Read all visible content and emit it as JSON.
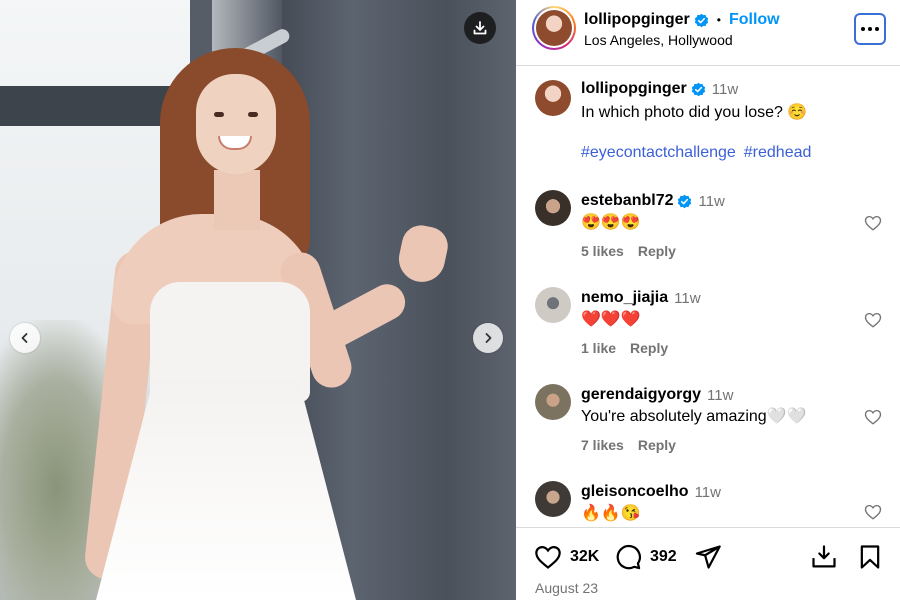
{
  "post": {
    "photo_alt_icons": {
      "download": "download-icon",
      "prev": "chevron-left-icon",
      "next": "chevron-right-icon"
    }
  },
  "header": {
    "username": "lollipopginger",
    "dot": "•",
    "follow_label": "Follow",
    "location": "Los Angeles, Hollywood",
    "more_icon": "more-options-icon"
  },
  "caption": {
    "username": "lollipopginger",
    "time": "11w",
    "text": "In which photo did you lose? ☺️",
    "hashtags": [
      "#eyecontactchallenge",
      "#redhead"
    ]
  },
  "comments": [
    {
      "username": "estebanbl72",
      "verified": true,
      "time": "11w",
      "text": "😍😍😍",
      "likes": "5 likes",
      "reply": "Reply",
      "avatar_color": "#5a4a40"
    },
    {
      "username": "nemo_jiajia",
      "verified": false,
      "time": "11w",
      "text": "❤️❤️❤️",
      "likes": "1 like",
      "reply": "Reply",
      "avatar_color": "#b9b4ad"
    },
    {
      "username": "gerendaigyorgy",
      "verified": false,
      "time": "11w",
      "text": "You're absolutely amazing🤍🤍",
      "likes": "7 likes",
      "reply": "Reply",
      "avatar_color": "#7c7260"
    },
    {
      "username": "gleisoncoelho",
      "verified": false,
      "time": "11w",
      "text": "🔥🔥😘",
      "likes": "",
      "reply": "",
      "avatar_color": "#8c8a86"
    }
  ],
  "actions": {
    "like_count": "32K",
    "comment_count": "392",
    "date": "August 23"
  },
  "colors": {
    "link": "#0095f6",
    "hashtag": "#3b5fd8",
    "muted": "#737373",
    "verified": "#0095f6"
  }
}
